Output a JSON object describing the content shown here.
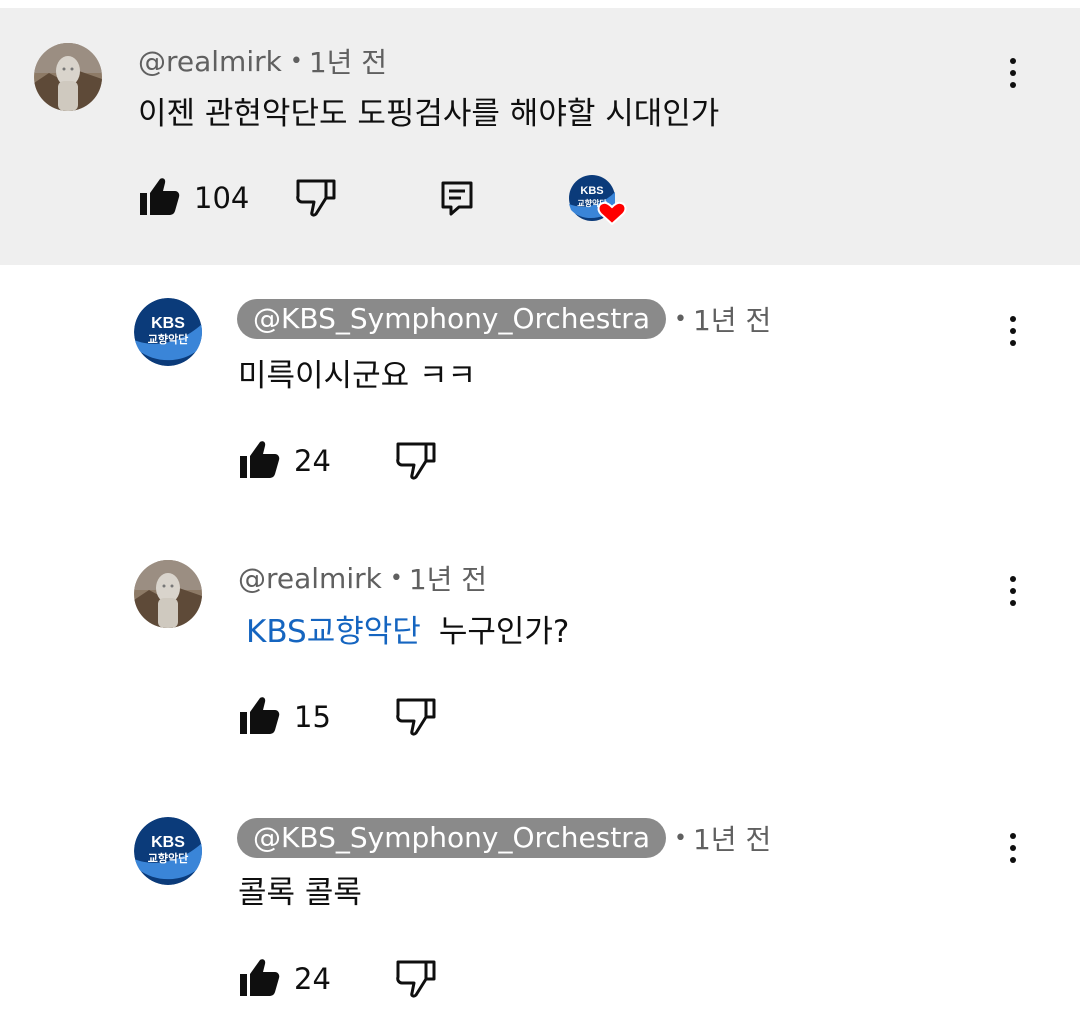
{
  "comments": [
    {
      "handle": "@realmirk",
      "time": "1년 전",
      "text": "이젠 관현악단도  도핑검사를 해야할 시대인가",
      "likes": "104",
      "hearted_by": "KBS교향악단"
    },
    {
      "handle": "@KBS_Symphony_Orchestra",
      "time": "1년 전",
      "text": "미륵이시군요 ㅋㅋ",
      "likes": "24"
    },
    {
      "handle": "@realmirk",
      "time": "1년 전",
      "mention": "KBS교향악단",
      "text": "누구인가?",
      "likes": "15"
    },
    {
      "handle": "@KBS_Symphony_Orchestra",
      "time": "1년 전",
      "text": "콜록 콜록",
      "likes": "24"
    }
  ],
  "dot_separator": "•",
  "kbs_logo": {
    "top": "KBS",
    "bottom": "교향악단"
  },
  "colors": {
    "highlight_bg": "#efefef",
    "mention": "#1565c0",
    "chip": "#8a8a8a",
    "heart": "#ff0000",
    "kbs_navy": "#0b3b7a"
  }
}
